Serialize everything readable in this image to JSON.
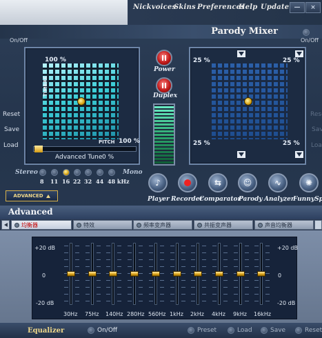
{
  "menu": {
    "items": [
      "Nickvoices",
      "Skins",
      "Preferences",
      "Help",
      "Update"
    ],
    "minimize": "—",
    "close": "×"
  },
  "window": {
    "title": "Parody Mixer",
    "on_off": "On/Off"
  },
  "side": {
    "reset": "Reset",
    "save": "Save",
    "load": "Load"
  },
  "pitch": {
    "corner_tl": "100 %",
    "axis_v": "TIMBRE",
    "axis_h": "PITCH",
    "corner_br": "100 %",
    "advanced_tune_label": "Advanced Tune",
    "advanced_tune_value": "0 %"
  },
  "duplex_grid": {
    "tl": "25 %",
    "tr": "25 %",
    "bl": "25 %",
    "br": "25 %"
  },
  "center": {
    "power": "Power",
    "duplex": "Duplex"
  },
  "stereo": {
    "left": "Stereo",
    "right": "Mono",
    "values": [
      "8",
      "11",
      "16",
      "22",
      "32",
      "44",
      "48 kHz"
    ],
    "selected_index": 2
  },
  "advanced_button": "ADVANCED",
  "buttons": [
    {
      "label": "Player",
      "icon": "music-note-icon"
    },
    {
      "label": "Recorder",
      "icon": "record-icon"
    },
    {
      "label": "Comparator",
      "icon": "comparator-icon"
    },
    {
      "label": "Parody",
      "icon": "parody-icon"
    },
    {
      "label": "Analyzer",
      "icon": "analyzer-icon"
    },
    {
      "label": "FunnySpo",
      "icon": "funny-icon"
    }
  ],
  "advanced": {
    "title": "Advanced"
  },
  "tabs": [
    "均衡器",
    "特效",
    "频率变声器",
    "共振变声器",
    "声音均衡器"
  ],
  "eq": {
    "top": "+20 dB",
    "mid": "0",
    "bottom": "-20 dB",
    "bands": [
      "30Hz",
      "75Hz",
      "140Hz",
      "280Hz",
      "560Hz",
      "1kHz",
      "2kHz",
      "4kHz",
      "9kHz",
      "16kHz"
    ]
  },
  "footer": {
    "equalizer": "Equalizer",
    "on_off": "On/Off",
    "preset": "Preset",
    "load": "Load",
    "save": "Save",
    "reset": "Reset"
  }
}
